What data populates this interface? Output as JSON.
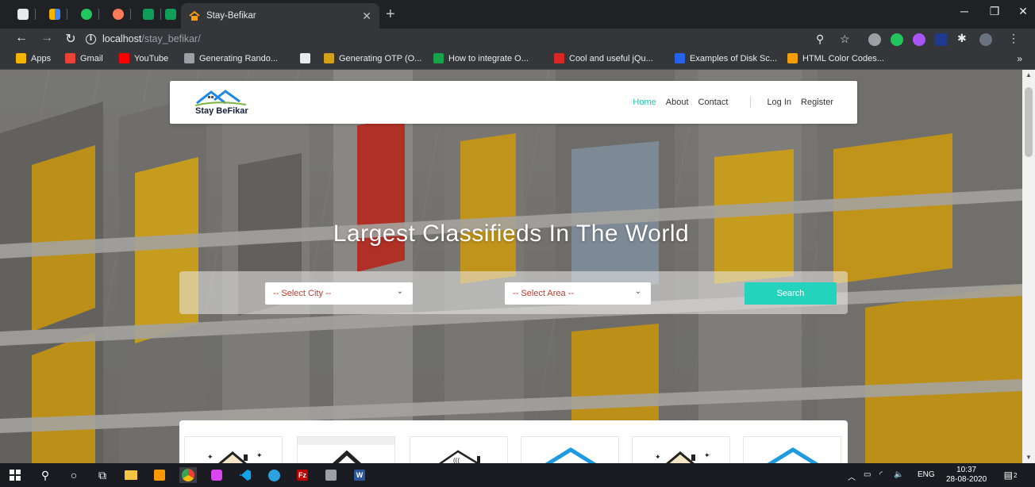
{
  "browser": {
    "tab_title": "Stay-Befikar",
    "url_host": "localhost",
    "url_path": "/stay_befikar/",
    "bookmarks": [
      {
        "label": "Apps",
        "icon": "apps-grid-icon",
        "color": "#f4b400"
      },
      {
        "label": "Gmail",
        "icon": "gmail-icon",
        "color": "#ea4335"
      },
      {
        "label": "YouTube",
        "icon": "youtube-icon",
        "color": "#ff0000"
      },
      {
        "label": "Generating Rando...",
        "icon": "dg-icon",
        "color": "#9aa0a6"
      },
      {
        "label": "",
        "icon": "github-icon",
        "color": "#e8eaed"
      },
      {
        "label": "Generating OTP (O...",
        "icon": "dg-icon",
        "color": "#d4a017"
      },
      {
        "label": "How to integrate O...",
        "icon": "s-icon",
        "color": "#16a34a"
      },
      {
        "label": "Cool and useful jQu...",
        "icon": "bookmark-red-icon",
        "color": "#dc2626"
      },
      {
        "label": "Examples of Disk Sc...",
        "icon": "cs-icon",
        "color": "#2563eb"
      },
      {
        "label": "HTML Color Codes...",
        "icon": "r-icon",
        "color": "#f59e0b"
      }
    ],
    "bookmarks_more": "»"
  },
  "site": {
    "logo_text": "Stay BeFikar",
    "nav": {
      "home": "Home",
      "about": "About",
      "contact": "Contact",
      "login": "Log In",
      "register": "Register"
    },
    "hero_title": "Largest Classifieds In The World",
    "search": {
      "city_placeholder": "-- Select City --",
      "area_placeholder": "-- Select Area --",
      "button": "Search"
    },
    "accent_color": "#25d3bd"
  },
  "taskbar": {
    "language": "ENG",
    "time": "10:37",
    "date": "28-08-2020",
    "notifications": "2"
  }
}
